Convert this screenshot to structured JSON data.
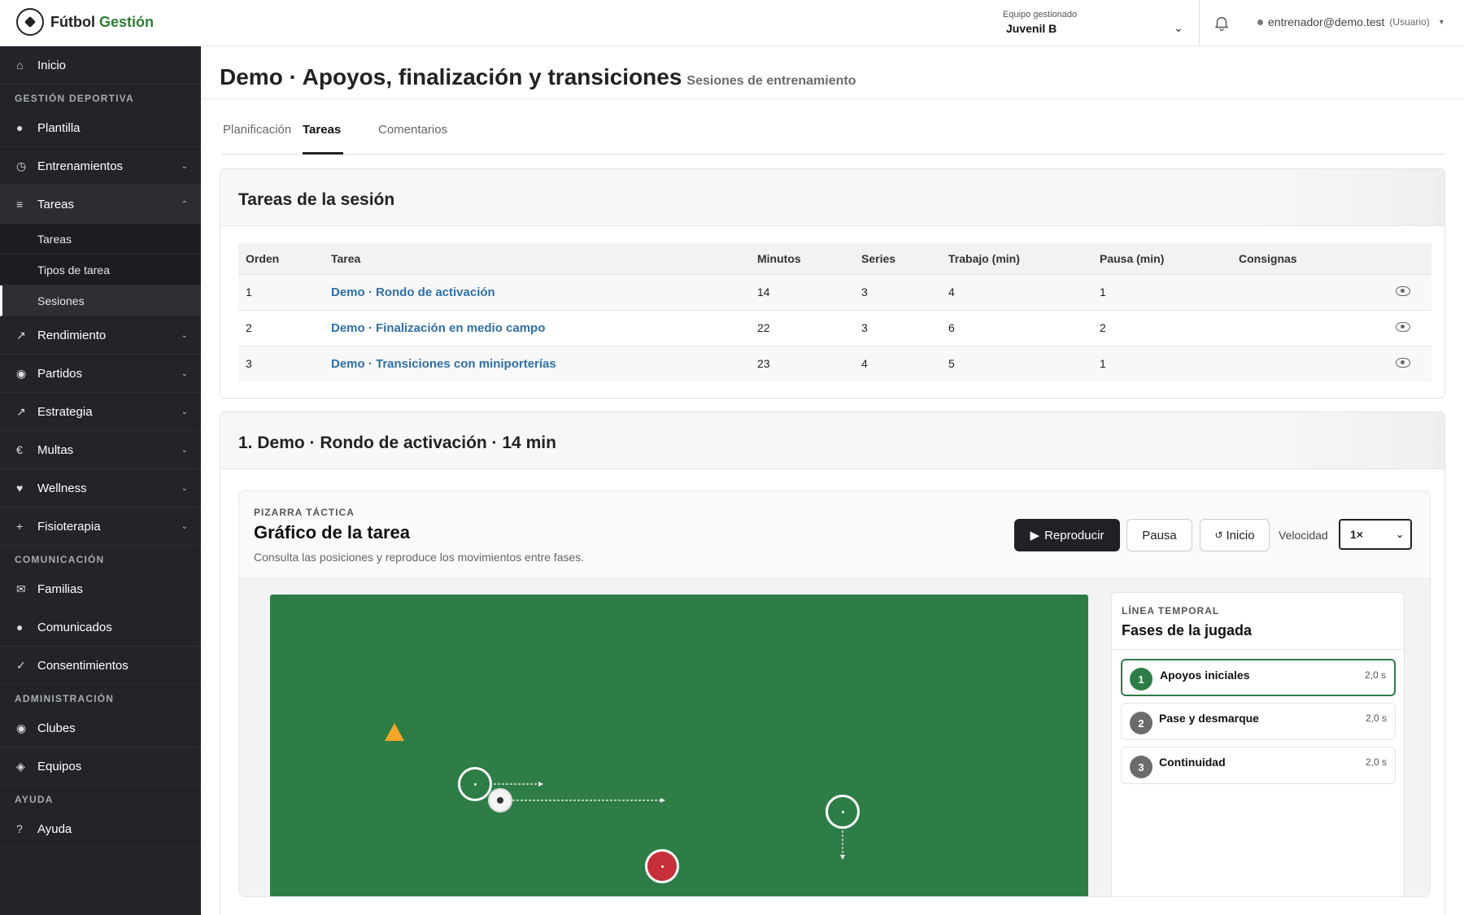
{
  "brand": {
    "name_part1": "Fútbol ",
    "name_part2": "Gestión"
  },
  "header": {
    "team_label": "Equipo gestionado",
    "team_value": "Juvenil B",
    "user_email": "entrenador@demo.test",
    "user_role": "(Usuario)"
  },
  "sidebar": {
    "inicio": "Inicio",
    "heading_deportiva": "GESTIÓN DEPORTIVA",
    "plantilla": "Plantilla",
    "entrenamientos": "Entrenamientos",
    "tareas": "Tareas",
    "sub_tareas": "Tareas",
    "sub_tipos": "Tipos de tarea",
    "sub_sesiones": "Sesiones",
    "rendimiento": "Rendimiento",
    "partidos": "Partidos",
    "estrategia": "Estrategia",
    "multas": "Multas",
    "wellness": "Wellness",
    "fisioterapia": "Fisioterapia",
    "heading_comunicacion": "COMUNICACIÓN",
    "familias": "Familias",
    "comunicados": "Comunicados",
    "consentimientos": "Consentimientos",
    "heading_admin": "ADMINISTRACIÓN",
    "clubes": "Clubes",
    "equipos": "Equipos",
    "heading_ayuda": "AYUDA",
    "ayuda": "Ayuda"
  },
  "page": {
    "title": "Demo · Apoyos, finalización y transiciones",
    "subtitle": "Sesiones de entrenamiento"
  },
  "tabs": [
    "Planificación",
    "Tareas",
    "Comentarios"
  ],
  "tasks_card": {
    "title": "Tareas de la sesión",
    "columns": [
      "Orden",
      "Tarea",
      "Minutos",
      "Series",
      "Trabajo (min)",
      "Pausa (min)",
      "Consignas"
    ],
    "rows": [
      {
        "orden": "1",
        "tarea": "Demo · Rondo de activación",
        "minutos": "14",
        "series": "3",
        "trabajo": "4",
        "pausa": "1",
        "consignas": ""
      },
      {
        "orden": "2",
        "tarea": "Demo · Finalización en medio campo",
        "minutos": "22",
        "series": "3",
        "trabajo": "6",
        "pausa": "2",
        "consignas": ""
      },
      {
        "orden": "3",
        "tarea": "Demo · Transiciones con miniporterías",
        "minutos": "23",
        "series": "4",
        "trabajo": "5",
        "pausa": "1",
        "consignas": ""
      }
    ]
  },
  "task_detail": {
    "title": "1. Demo · Rondo de activación · 14 min",
    "kicker": "PIZARRA TÁCTICA",
    "board_title": "Gráfico de la tarea",
    "board_desc": "Consulta las posiciones y reproduce los movimientos entre fases.",
    "play_label": "Reproducir",
    "pause_label": "Pausa",
    "start_label": "Inicio",
    "speed_label": "Velocidad",
    "speed_value": "1×"
  },
  "timeline": {
    "kicker": "LÍNEA TEMPORAL",
    "title": "Fases de la jugada",
    "phases": [
      {
        "num": "1",
        "label": "Apoyos iniciales",
        "time": "2,0 s"
      },
      {
        "num": "2",
        "label": "Pase y desmarque",
        "time": "2,0 s"
      },
      {
        "num": "3",
        "label": "Continuidad",
        "time": "2,0 s"
      }
    ]
  },
  "colors": {
    "accent_green": "#2e7d46",
    "sidebar_bg": "#222429",
    "link_blue": "#2f6fa8",
    "cone_orange": "#f4a52a",
    "rival_red": "#c6303a"
  }
}
